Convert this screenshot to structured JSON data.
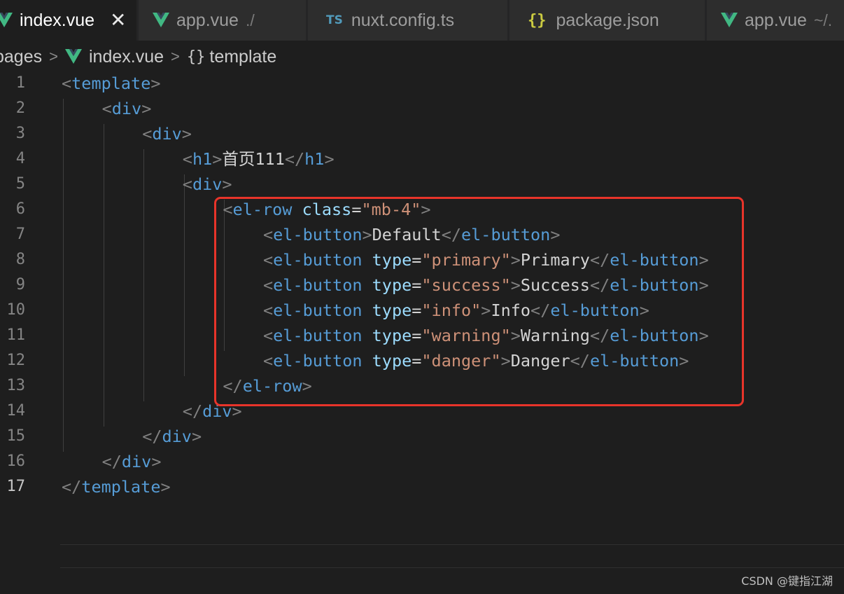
{
  "tabs": [
    {
      "label": "index.vue",
      "suffix": "",
      "icon": "vue-icon",
      "active": true
    },
    {
      "label": "app.vue",
      "suffix": "./",
      "icon": "vue-icon",
      "active": false
    },
    {
      "label": "nuxt.config.ts",
      "suffix": "",
      "icon": "ts-icon",
      "icon_text": "TS",
      "active": false
    },
    {
      "label": "package.json",
      "suffix": "",
      "icon": "json-icon",
      "icon_text": "{}",
      "active": false
    },
    {
      "label": "app.vue",
      "suffix": "~/.",
      "icon": "vue-icon",
      "active": false
    }
  ],
  "tab_close_symbol": "✕",
  "breadcrumb": {
    "folder": "pages",
    "file": "index.vue",
    "symbol_icon_text": "{}",
    "symbol": "template"
  },
  "editor": {
    "current_line": 17,
    "lines": [
      {
        "n": "1",
        "tokens": [
          [
            "punc",
            "<"
          ],
          [
            "tag",
            "template"
          ],
          [
            "punc",
            ">"
          ]
        ]
      },
      {
        "n": "2",
        "tokens": [
          [
            "punc",
            "<"
          ],
          [
            "tag",
            "div"
          ],
          [
            "punc",
            ">"
          ]
        ]
      },
      {
        "n": "3",
        "tokens": [
          [
            "punc",
            "<"
          ],
          [
            "tag",
            "div"
          ],
          [
            "punc",
            ">"
          ]
        ]
      },
      {
        "n": "4",
        "tokens": [
          [
            "punc",
            "<"
          ],
          [
            "tag",
            "h1"
          ],
          [
            "punc",
            ">"
          ],
          [
            "text",
            "首页111"
          ],
          [
            "punc",
            "</"
          ],
          [
            "tag",
            "h1"
          ],
          [
            "punc",
            ">"
          ]
        ]
      },
      {
        "n": "5",
        "tokens": [
          [
            "punc",
            "<"
          ],
          [
            "tag",
            "div"
          ],
          [
            "punc",
            ">"
          ]
        ]
      },
      {
        "n": "6",
        "tokens": [
          [
            "punc",
            "<"
          ],
          [
            "tag",
            "el-row"
          ],
          [
            "text",
            " "
          ],
          [
            "attr",
            "class"
          ],
          [
            "text",
            "="
          ],
          [
            "str",
            "\"mb-4\""
          ],
          [
            "punc",
            ">"
          ]
        ]
      },
      {
        "n": "7",
        "tokens": [
          [
            "punc",
            "<"
          ],
          [
            "tag",
            "el-button"
          ],
          [
            "punc",
            ">"
          ],
          [
            "text",
            "Default"
          ],
          [
            "punc",
            "</"
          ],
          [
            "tag",
            "el-button"
          ],
          [
            "punc",
            ">"
          ]
        ]
      },
      {
        "n": "8",
        "tokens": [
          [
            "punc",
            "<"
          ],
          [
            "tag",
            "el-button"
          ],
          [
            "text",
            " "
          ],
          [
            "attr",
            "type"
          ],
          [
            "text",
            "="
          ],
          [
            "str",
            "\"primary\""
          ],
          [
            "punc",
            ">"
          ],
          [
            "text",
            "Primary"
          ],
          [
            "punc",
            "</"
          ],
          [
            "tag",
            "el-button"
          ],
          [
            "punc",
            ">"
          ]
        ]
      },
      {
        "n": "9",
        "tokens": [
          [
            "punc",
            "<"
          ],
          [
            "tag",
            "el-button"
          ],
          [
            "text",
            " "
          ],
          [
            "attr",
            "type"
          ],
          [
            "text",
            "="
          ],
          [
            "str",
            "\"success\""
          ],
          [
            "punc",
            ">"
          ],
          [
            "text",
            "Success"
          ],
          [
            "punc",
            "</"
          ],
          [
            "tag",
            "el-button"
          ],
          [
            "punc",
            ">"
          ]
        ]
      },
      {
        "n": "10",
        "tokens": [
          [
            "punc",
            "<"
          ],
          [
            "tag",
            "el-button"
          ],
          [
            "text",
            " "
          ],
          [
            "attr",
            "type"
          ],
          [
            "text",
            "="
          ],
          [
            "str",
            "\"info\""
          ],
          [
            "punc",
            ">"
          ],
          [
            "text",
            "Info"
          ],
          [
            "punc",
            "</"
          ],
          [
            "tag",
            "el-button"
          ],
          [
            "punc",
            ">"
          ]
        ]
      },
      {
        "n": "11",
        "tokens": [
          [
            "punc",
            "<"
          ],
          [
            "tag",
            "el-button"
          ],
          [
            "text",
            " "
          ],
          [
            "attr",
            "type"
          ],
          [
            "text",
            "="
          ],
          [
            "str",
            "\"warning\""
          ],
          [
            "punc",
            ">"
          ],
          [
            "text",
            "Warning"
          ],
          [
            "punc",
            "</"
          ],
          [
            "tag",
            "el-button"
          ],
          [
            "punc",
            ">"
          ]
        ]
      },
      {
        "n": "12",
        "tokens": [
          [
            "punc",
            "<"
          ],
          [
            "tag",
            "el-button"
          ],
          [
            "text",
            " "
          ],
          [
            "attr",
            "type"
          ],
          [
            "text",
            "="
          ],
          [
            "str",
            "\"danger\""
          ],
          [
            "punc",
            ">"
          ],
          [
            "text",
            "Danger"
          ],
          [
            "punc",
            "</"
          ],
          [
            "tag",
            "el-button"
          ],
          [
            "punc",
            ">"
          ]
        ]
      },
      {
        "n": "13",
        "tokens": [
          [
            "punc",
            "</"
          ],
          [
            "tag",
            "el-row"
          ],
          [
            "punc",
            ">"
          ]
        ]
      },
      {
        "n": "14",
        "tokens": [
          [
            "punc",
            "</"
          ],
          [
            "tag",
            "div"
          ],
          [
            "punc",
            ">"
          ]
        ]
      },
      {
        "n": "15",
        "tokens": [
          [
            "punc",
            "</"
          ],
          [
            "tag",
            "div"
          ],
          [
            "punc",
            ">"
          ]
        ]
      },
      {
        "n": "16",
        "tokens": [
          [
            "punc",
            "</"
          ],
          [
            "tag",
            "div"
          ],
          [
            "punc",
            ">"
          ]
        ]
      },
      {
        "n": "17",
        "tokens": [
          [
            "punc",
            "</"
          ],
          [
            "tag",
            "template"
          ],
          [
            "punc",
            ">"
          ]
        ]
      }
    ]
  },
  "watermark": "CSDN @键指江湖",
  "colors": {
    "tag": "#569cd6",
    "attribute": "#9cdcfe",
    "string": "#ce9178",
    "punctuation": "#808080",
    "text": "#d4d4d4",
    "highlight_box": "#e8342a",
    "vue_green": "#41b883"
  }
}
